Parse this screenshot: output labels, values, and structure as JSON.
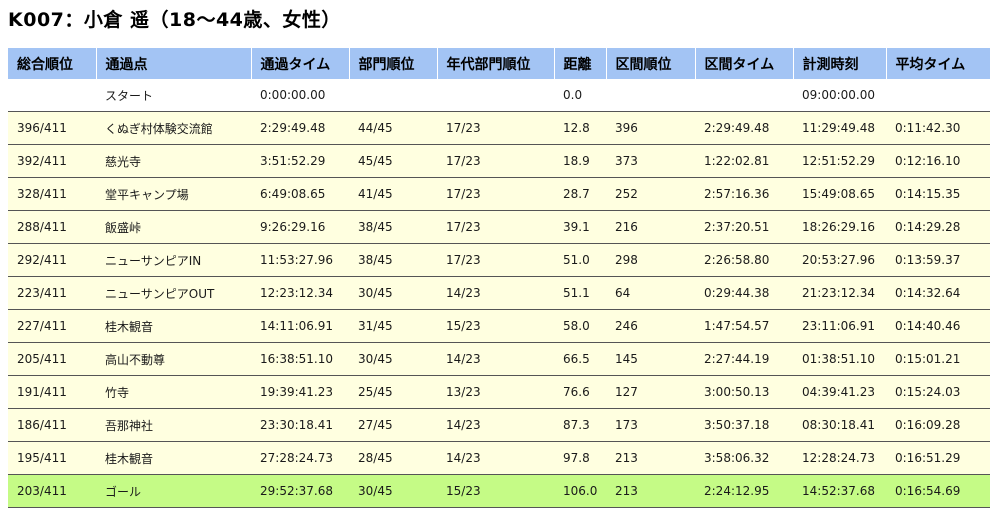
{
  "title": "K007：小倉 遥（18～44歳、女性）",
  "table": {
    "headers": [
      "総合順位",
      "通過点",
      "通過タイム",
      "部門順位",
      "年代部門順位",
      "距離",
      "区間順位",
      "区間タイム",
      "計測時刻",
      "平均タイム"
    ],
    "rows": [
      [
        "",
        "スタート",
        "0:00:00.00",
        "",
        "",
        "0.0",
        "",
        "",
        "09:00:00.00",
        ""
      ],
      [
        "396/411",
        "くぬぎ村体験交流館",
        "2:29:49.48",
        "44/45",
        "17/23",
        "12.8",
        "396",
        "2:29:49.48",
        "11:29:49.48",
        "0:11:42.30"
      ],
      [
        "392/411",
        "慈光寺",
        "3:51:52.29",
        "45/45",
        "17/23",
        "18.9",
        "373",
        "1:22:02.81",
        "12:51:52.29",
        "0:12:16.10"
      ],
      [
        "328/411",
        "堂平キャンプ場",
        "6:49:08.65",
        "41/45",
        "17/23",
        "28.7",
        "252",
        "2:57:16.36",
        "15:49:08.65",
        "0:14:15.35"
      ],
      [
        "288/411",
        "飯盛峠",
        "9:26:29.16",
        "38/45",
        "17/23",
        "39.1",
        "216",
        "2:37:20.51",
        "18:26:29.16",
        "0:14:29.28"
      ],
      [
        "292/411",
        "ニューサンピアIN",
        "11:53:27.96",
        "38/45",
        "17/23",
        "51.0",
        "298",
        "2:26:58.80",
        "20:53:27.96",
        "0:13:59.37"
      ],
      [
        "223/411",
        "ニューサンピアOUT",
        "12:23:12.34",
        "30/45",
        "14/23",
        "51.1",
        "64",
        "0:29:44.38",
        "21:23:12.34",
        "0:14:32.64"
      ],
      [
        "227/411",
        "桂木観音",
        "14:11:06.91",
        "31/45",
        "15/23",
        "58.0",
        "246",
        "1:47:54.57",
        "23:11:06.91",
        "0:14:40.46"
      ],
      [
        "205/411",
        "高山不動尊",
        "16:38:51.10",
        "30/45",
        "14/23",
        "66.5",
        "145",
        "2:27:44.19",
        "01:38:51.10",
        "0:15:01.21"
      ],
      [
        "191/411",
        "竹寺",
        "19:39:41.23",
        "25/45",
        "13/23",
        "76.6",
        "127",
        "3:00:50.13",
        "04:39:41.23",
        "0:15:24.03"
      ],
      [
        "186/411",
        "吾那神社",
        "23:30:18.41",
        "27/45",
        "14/23",
        "87.3",
        "173",
        "3:50:37.18",
        "08:30:18.41",
        "0:16:09.28"
      ],
      [
        "195/411",
        "桂木観音",
        "27:28:24.73",
        "28/45",
        "14/23",
        "97.8",
        "213",
        "3:58:06.32",
        "12:28:24.73",
        "0:16:51.29"
      ],
      [
        "203/411",
        "ゴール",
        "29:52:37.68",
        "30/45",
        "15/23",
        "106.0",
        "213",
        "2:24:12.95",
        "14:52:37.68",
        "0:16:54.69"
      ]
    ]
  },
  "colors": {
    "header_bg": "#a3c4f4",
    "row_bg": "#ffffe0",
    "goal_bg": "#c5fb86"
  }
}
